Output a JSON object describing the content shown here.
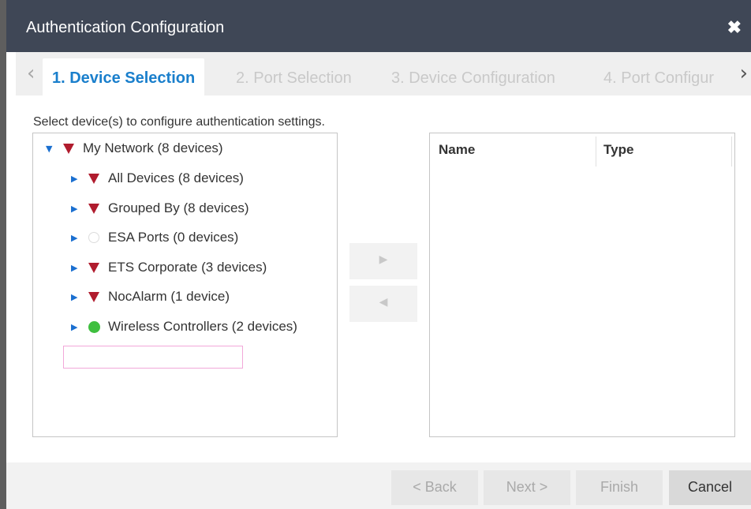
{
  "dialog": {
    "title": "Authentication Configuration",
    "close_glyph": "✖"
  },
  "tabs": {
    "prev_glyph": "‹",
    "next_glyph": "›",
    "items": [
      {
        "label": "1. Device Selection",
        "active": true
      },
      {
        "label": "2. Port Selection",
        "active": false
      },
      {
        "label": "3. Device Configuration",
        "active": false
      },
      {
        "label": "4. Port Configur",
        "active": false
      }
    ]
  },
  "instruction": "Select device(s) to configure authentication settings.",
  "tree": {
    "root": {
      "label": "My Network (8 devices)",
      "icon": "red-triangle-icon",
      "expanded": true
    },
    "children": [
      {
        "label": "All Devices (8 devices)",
        "icon": "red-triangle-icon"
      },
      {
        "label": "Grouped By (8 devices)",
        "icon": "red-triangle-icon"
      },
      {
        "label": "ESA Ports (0 devices)",
        "icon": "empty-circle-icon"
      },
      {
        "label": "ETS Corporate (3 devices)",
        "icon": "red-triangle-icon"
      },
      {
        "label": "NocAlarm (1 device)",
        "icon": "red-triangle-icon"
      },
      {
        "label": "Wireless Controllers (2 devices)",
        "icon": "green-circle-icon"
      }
    ],
    "expanded_glyph": "▼",
    "collapsed_glyph": "▶"
  },
  "transfer": {
    "add_glyph": "▶",
    "remove_glyph": "◀"
  },
  "selected_list": {
    "columns": [
      "Name",
      "Type"
    ]
  },
  "footer": {
    "back_label": "< Back",
    "next_label": "Next >",
    "finish_label": "Finish",
    "cancel_label": "Cancel"
  },
  "colors": {
    "titlebar": "#3f4756",
    "active_tab": "#1a7fcc",
    "critical": "#b01c2e",
    "ok": "#3fbf3f"
  }
}
